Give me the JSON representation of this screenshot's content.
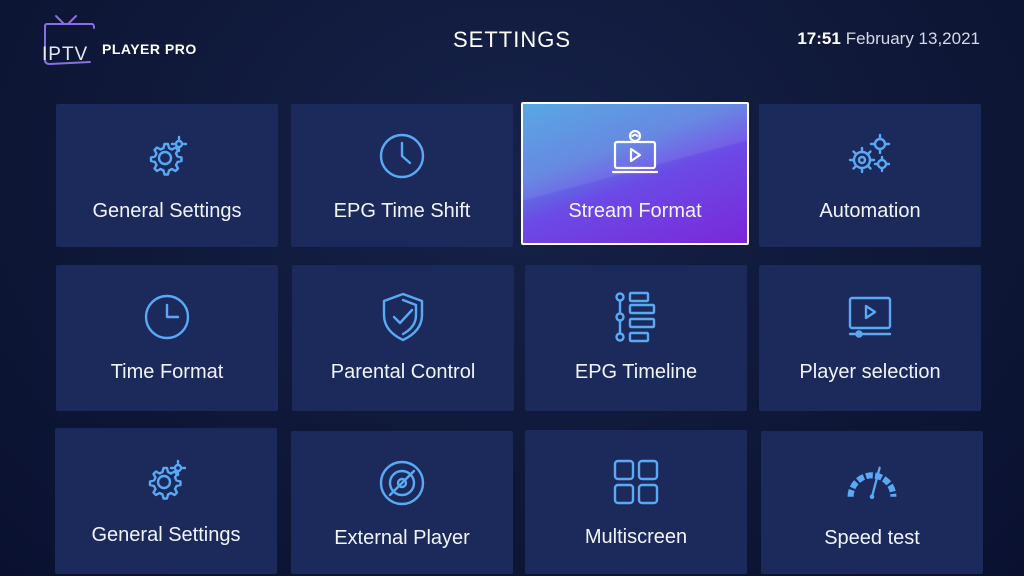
{
  "header": {
    "logo_text": "IPTV",
    "logo_subtext": "PLAYER PRO",
    "title": "SETTINGS",
    "time": "17:51",
    "date": "February 13,2021"
  },
  "tiles": [
    {
      "label": "General Settings",
      "icon": "gears-icon"
    },
    {
      "label": "EPG Time Shift",
      "icon": "clock-icon"
    },
    {
      "label": "Stream Format",
      "icon": "stream-monitor-icon",
      "selected": true
    },
    {
      "label": "Automation",
      "icon": "automation-gears-icon"
    },
    {
      "label": "Time Format",
      "icon": "clock-icon"
    },
    {
      "label": "Parental  Control",
      "icon": "shield-check-icon"
    },
    {
      "label": "EPG Timeline",
      "icon": "timeline-icon"
    },
    {
      "label": "Player selection",
      "icon": "video-player-icon"
    },
    {
      "label": "General Settings",
      "icon": "gears-icon"
    },
    {
      "label": "External Player",
      "icon": "disc-slash-icon"
    },
    {
      "label": "Multiscreen",
      "icon": "grid-icon"
    },
    {
      "label": "Speed test",
      "icon": "speedometer-icon"
    }
  ],
  "colors": {
    "background": "#0f1838",
    "tile": "#1b2a5b",
    "icon": "#5aa9f5",
    "selected_gradient_start": "#4aa0e0",
    "selected_gradient_end": "#7a28d8"
  }
}
